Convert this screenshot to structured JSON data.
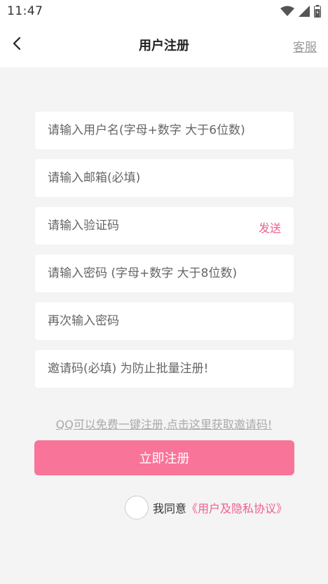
{
  "status_bar": {
    "time": "11:47",
    "icons": [
      "wifi-icon",
      "signal-icon",
      "battery-icon"
    ]
  },
  "header": {
    "back_icon": "chevron-left-icon",
    "title": "用户注册",
    "service_label": "客服"
  },
  "form": {
    "username_placeholder": "请输入用户名(字母+数字 大于6位数)",
    "email_placeholder": "请输入邮箱(必填)",
    "code_placeholder": "请输入验证码",
    "send_label": "发送",
    "password_placeholder": "请输入密码 (字母+数字 大于8位数)",
    "confirm_placeholder": "再次输入密码",
    "invite_placeholder": "邀请码(必填) 为防止批量注册!"
  },
  "qq_hint": "QQ可以免费一键注册,点击这里获取邀请码!",
  "register_label": "立即注册",
  "agreement": {
    "checked": false,
    "prefix": "我同意",
    "link": "《用户及隐私协议》"
  },
  "colors": {
    "accent": "#f87499",
    "link": "#f0608e",
    "background": "#f4f4f4"
  }
}
